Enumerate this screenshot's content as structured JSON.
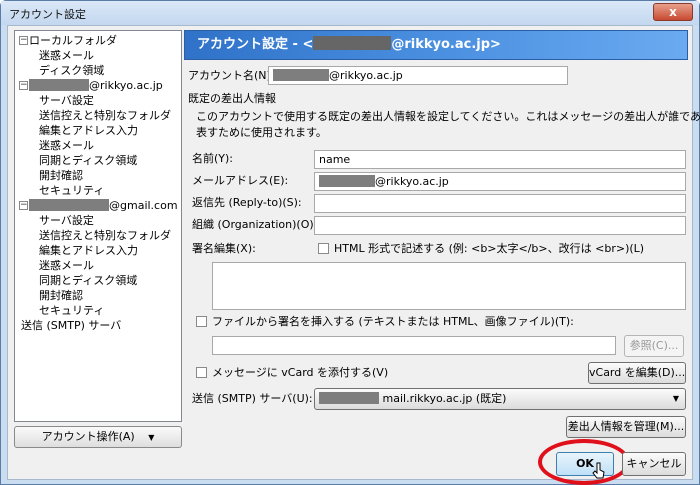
{
  "window": {
    "title": "アカウント設定",
    "close_glyph": "x"
  },
  "tree": {
    "local_folder": "ローカルフォルダ",
    "local_children": [
      "迷惑メール",
      "ディスク領域"
    ],
    "account1_domain": "@rikkyo.ac.jp",
    "account1_children": [
      "サーバ設定",
      "送信控えと特別なフォルダ",
      "編集とアドレス入力",
      "迷惑メール",
      "同期とディスク領域",
      "開封確認",
      "セキュリティ"
    ],
    "account2_domain": "@gmail.com",
    "account2_children": [
      "サーバ設定",
      "送信控えと特別なフォルダ",
      "編集とアドレス入力",
      "迷惑メール",
      "同期とディスク領域",
      "開封確認",
      "セキュリティ"
    ],
    "smtp": "送信 (SMTP) サーバ",
    "toggle_minus": "−"
  },
  "account_ops_button": "アカウント操作(A)",
  "header": {
    "prefix": "アカウント設定 - <",
    "suffix": "@rikkyo.ac.jp>"
  },
  "account_name": {
    "label": "アカウント名(N):",
    "value_domain": "@rikkyo.ac.jp"
  },
  "identity": {
    "section_title": "既定の差出人情報",
    "description_line1": "このアカウントで使用する既定の差出人情報を設定してください。これはメッセージの差出人が誰であるかを",
    "description_line2": "表すために使用されます。",
    "name_label": "名前(Y):",
    "name_value": "name",
    "email_label": "メールアドレス(E):",
    "email_domain": "@rikkyo.ac.jp",
    "replyto_label": "返信先 (Reply-to)(S):",
    "replyto_value": "",
    "org_label": "組織 (Organization)(O):",
    "org_value": "",
    "signature_label": "署名編集(X):",
    "html_checkbox_label": "HTML 形式で記述する (例: <b>太字</b>、改行は <br>)(L)",
    "file_sig_label": "ファイルから署名を挿入する (テキストまたは HTML、画像ファイル)(T):",
    "browse_button": "参照(C)...",
    "vcard_label": "メッセージに vCard を添付する(V)",
    "vcard_button": "vCard を編集(D)...",
    "smtp_label": "送信 (SMTP) サーバ(U):",
    "smtp_value": "mail.rikkyo.ac.jp (既定)",
    "manage_button": "差出人情報を管理(M)..."
  },
  "ok_button": "OK",
  "cancel_button": "キャンセル",
  "colors": {
    "header_start": "#2f72c8",
    "header_end": "#6aaaf0",
    "highlight_ring": "#e0101a"
  }
}
